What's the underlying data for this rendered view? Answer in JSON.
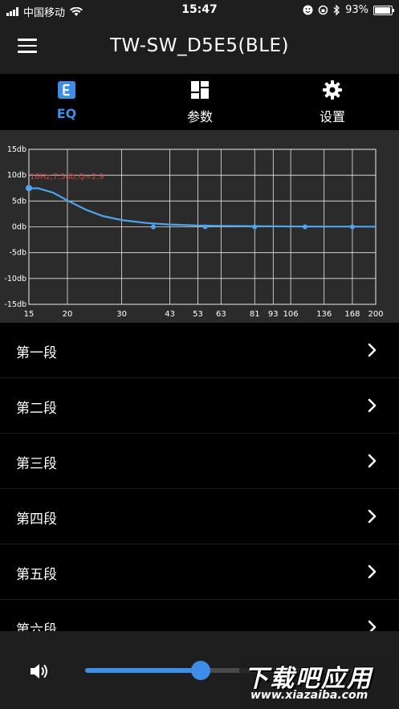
{
  "status_bar": {
    "carrier": "中国移动",
    "time": "15:47",
    "battery_percent": "93%",
    "battery_level": 0.93
  },
  "header": {
    "title": "TW-SW_D5E5(BLE)"
  },
  "tabs": [
    {
      "label": "EQ",
      "icon": "eq-icon",
      "active": true
    },
    {
      "label": "参数",
      "icon": "dashboard-icon",
      "active": false
    },
    {
      "label": "设置",
      "icon": "gear-icon",
      "active": false
    }
  ],
  "chart_data": {
    "type": "line",
    "y_tick_labels": [
      "15db",
      "10db",
      "5db",
      "0db",
      "-5db",
      "-10db",
      "-15db"
    ],
    "x_tick_labels": [
      "15",
      "20",
      "30",
      "43",
      "53",
      "63",
      "81",
      "93",
      "106",
      "136",
      "168",
      "200"
    ],
    "ylim": [
      -15,
      15
    ],
    "xlim": [
      15,
      200
    ],
    "x_scale": "log",
    "grid": true,
    "annotation": "16Hz,7.5db,Q=2.9",
    "series": [
      {
        "color": "#4ea4ee",
        "x": [
          15,
          16,
          18,
          20,
          23,
          26,
          30,
          36,
          43,
          53,
          63,
          81,
          106,
          136,
          168,
          200
        ],
        "y": [
          7.4,
          7.5,
          6.6,
          5.1,
          3.3,
          2.1,
          1.3,
          0.75,
          0.45,
          0.25,
          0.18,
          0.12,
          0.08,
          0.05,
          0.04,
          0.03
        ]
      }
    ],
    "points": [
      {
        "x": 15,
        "y": 7.5
      },
      {
        "x": 38,
        "y": 0
      },
      {
        "x": 56,
        "y": 0
      },
      {
        "x": 81,
        "y": 0
      },
      {
        "x": 118,
        "y": 0
      },
      {
        "x": 168,
        "y": 0
      }
    ]
  },
  "list": {
    "items": [
      {
        "label": "第一段"
      },
      {
        "label": "第二段"
      },
      {
        "label": "第三段"
      },
      {
        "label": "第四段"
      },
      {
        "label": "第五段"
      },
      {
        "label": "第六段"
      }
    ]
  },
  "volume": {
    "icon": "speaker-icon",
    "level": 0.4
  },
  "watermark": {
    "cn": "下载吧应用",
    "en": "www.xiazaiba.com"
  },
  "colors": {
    "accent": "#3e8ee8",
    "annotation": "#d0463d",
    "chart_bg": "#2b2b2b"
  }
}
